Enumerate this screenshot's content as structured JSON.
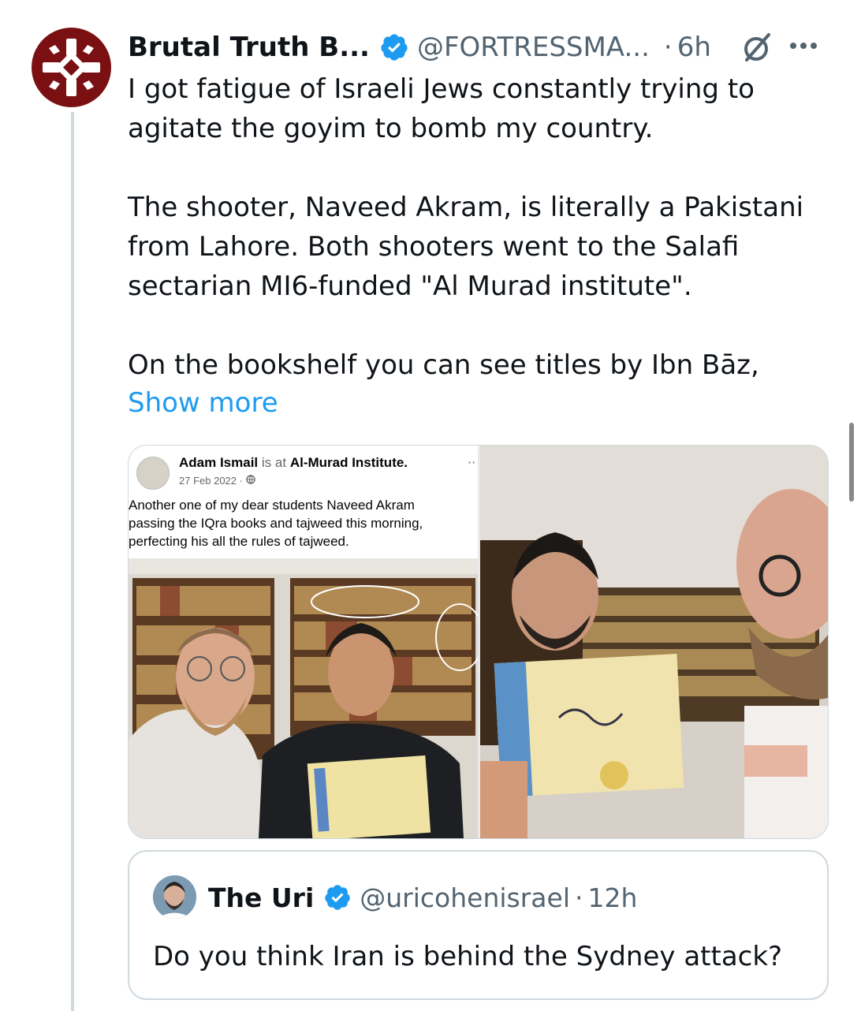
{
  "tweet": {
    "author_name": "Brutal Truth B...",
    "handle": "@FORTRESSMA...",
    "separator": "·",
    "time": "6h",
    "text": "I got fatigue of Israeli Jews constantly trying to\nagitate the goyim to bomb my country.\n\nThe shooter, Naveed Akram, is literally a Pakistani\nfrom Lahore. Both shooters went to the Salafi\nsectarian MI6-funded \"Al Murad institute\".\n\nOn the bookshelf you can see titles by Ibn Bāz,",
    "show_more_label": "Show more"
  },
  "media": {
    "left": {
      "fb_author": "Adam Ismail",
      "fb_is_at": "is at",
      "fb_place": "Al-Murad Institute.",
      "fb_date": "27 Feb 2022 ·",
      "fb_caption": "Another one of my dear students Naveed Akram\npassing the IQra books and tajweed this morning,\nperfecting his all the rules of tajweed.",
      "fb_more": "··"
    }
  },
  "quote": {
    "author_name": "The Uri",
    "handle": "@uricohenisrael",
    "separator": "·",
    "time": "12h",
    "text": "Do you think Iran is behind the Sydney attack?"
  },
  "colors": {
    "accent": "#1d9bf0",
    "secondary_text": "#536471",
    "avatar_bg": "#7a1012"
  }
}
